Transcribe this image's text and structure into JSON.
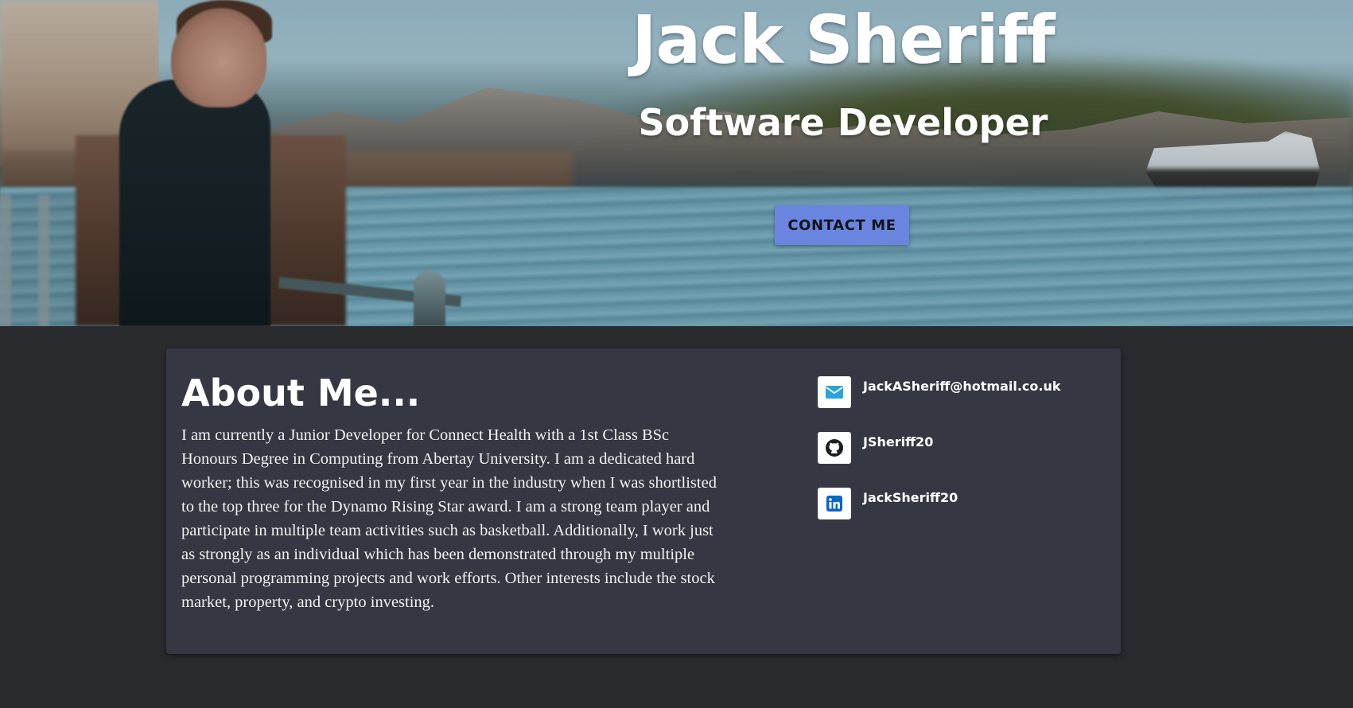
{
  "hero": {
    "name": "Jack Sheriff",
    "role": "Software Developer",
    "contact_button_label": "CONTACT ME"
  },
  "about": {
    "heading": "About Me...",
    "body": "I am currently a Junior Developer for Connect Health with a 1st Class BSc Honours Degree in Computing from Abertay University. I am a dedicated hard worker; this was recognised in my first year in the industry when I was shortlisted to the top three for the Dynamo Rising Star award. I am a strong team player and participate in multiple team activities such as basketball. Additionally, I work just as strongly as an individual which has been demonstrated through my multiple personal programming projects and work efforts. Other interests include the stock market, property, and crypto investing."
  },
  "contacts": [
    {
      "icon": "email-icon",
      "label": "JackASheriff@hotmail.co.uk",
      "icon_color": "#29a3dc"
    },
    {
      "icon": "github-icon",
      "label": "JSheriff20",
      "icon_color": "#1b1f23"
    },
    {
      "icon": "linkedin-icon",
      "label": "JackSheriff20",
      "icon_color": "#0a66c2"
    }
  ],
  "colors": {
    "page_background": "#2a2b2f",
    "card_background": "#353842",
    "button_accent": "#6a85e0"
  }
}
